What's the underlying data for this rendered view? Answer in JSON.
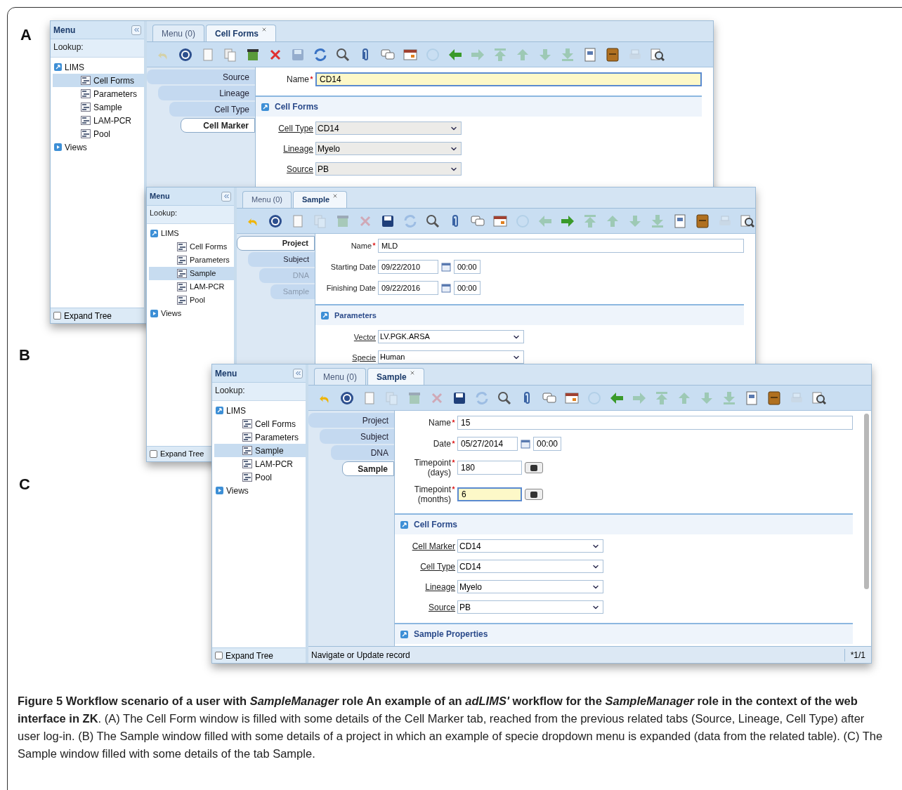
{
  "panel_labels": [
    "A",
    "B",
    "C"
  ],
  "windows": [
    {
      "sidebar": {
        "title": "Menu",
        "lookup": "Lookup:",
        "tree": [
          {
            "label": "LIMS",
            "expanded": true,
            "children": [
              {
                "label": "Cell Forms",
                "selected": true
              },
              {
                "label": "Parameters",
                "selected": false
              },
              {
                "label": "Sample",
                "selected": false
              },
              {
                "label": "LAM-PCR",
                "selected": false
              },
              {
                "label": "Pool",
                "selected": false
              }
            ]
          },
          {
            "label": "Views",
            "expanded": false
          }
        ],
        "expand_tree": {
          "label": "Expand Tree",
          "checked": false
        }
      },
      "tabs": [
        {
          "label": "Menu (0)",
          "selected": false,
          "closable": false
        },
        {
          "label": "Cell Forms",
          "selected": true,
          "closable": true
        }
      ],
      "toolbar": [
        {
          "kind": "undo",
          "disabled": true
        },
        {
          "kind": "help",
          "disabled": false
        },
        {
          "kind": "new",
          "disabled": false
        },
        {
          "kind": "copy",
          "disabled": false
        },
        {
          "kind": "bin",
          "disabled": false
        },
        {
          "kind": "delete",
          "disabled": false
        },
        {
          "kind": "save",
          "disabled": true
        },
        {
          "kind": "refresh",
          "disabled": false
        },
        {
          "kind": "search",
          "disabled": false
        },
        {
          "kind": "attach",
          "disabled": false
        },
        {
          "kind": "chat",
          "disabled": false
        },
        {
          "kind": "grid",
          "disabled": false
        },
        {
          "kind": "history",
          "disabled": true
        },
        {
          "kind": "back",
          "disabled": false
        },
        {
          "kind": "forward",
          "disabled": true
        },
        {
          "kind": "first",
          "disabled": true
        },
        {
          "kind": "up",
          "disabled": true
        },
        {
          "kind": "down",
          "disabled": true
        },
        {
          "kind": "last",
          "disabled": true
        },
        {
          "kind": "report",
          "disabled": false
        },
        {
          "kind": "archive",
          "disabled": false
        },
        {
          "kind": "print",
          "disabled": true
        },
        {
          "kind": "zoom",
          "disabled": false
        }
      ],
      "side_tabs": [
        {
          "label": "Source",
          "selected": false,
          "disabled": false
        },
        {
          "label": "Lineage",
          "selected": false,
          "disabled": false
        },
        {
          "label": "Cell Type",
          "selected": false,
          "disabled": false
        },
        {
          "label": "Cell Marker",
          "selected": true,
          "disabled": false
        }
      ],
      "fields": [
        {
          "kind": "text",
          "label": "Name",
          "required": true,
          "value": "CD14",
          "focused": true
        }
      ],
      "sections": [
        {
          "title": "Cell Forms",
          "fields": [
            {
              "kind": "select",
              "label": "Cell Type",
              "value": "CD14",
              "disabled": true
            },
            {
              "kind": "select",
              "label": "Lineage",
              "value": "Myelo",
              "disabled": true
            },
            {
              "kind": "select",
              "label": "Source",
              "value": "PB",
              "disabled": true
            }
          ]
        }
      ]
    },
    {
      "sidebar": {
        "title": "Menu",
        "lookup": "Lookup:",
        "tree": [
          {
            "label": "LIMS",
            "expanded": true,
            "children": [
              {
                "label": "Cell Forms",
                "selected": false
              },
              {
                "label": "Parameters",
                "selected": false
              },
              {
                "label": "Sample",
                "selected": true
              },
              {
                "label": "LAM-PCR",
                "selected": false
              },
              {
                "label": "Pool",
                "selected": false
              }
            ]
          },
          {
            "label": "Views",
            "expanded": false
          }
        ],
        "expand_tree": {
          "label": "Expand Tree",
          "checked": false
        }
      },
      "tabs": [
        {
          "label": "Menu (0)",
          "selected": false,
          "closable": false
        },
        {
          "label": "Sample",
          "selected": true,
          "closable": true
        }
      ],
      "toolbar": [
        {
          "kind": "undo",
          "disabled": false
        },
        {
          "kind": "help",
          "disabled": false
        },
        {
          "kind": "new",
          "disabled": false
        },
        {
          "kind": "copy",
          "disabled": true
        },
        {
          "kind": "bin",
          "disabled": true
        },
        {
          "kind": "delete",
          "disabled": true
        },
        {
          "kind": "save",
          "disabled": false
        },
        {
          "kind": "refresh",
          "disabled": true
        },
        {
          "kind": "search",
          "disabled": false
        },
        {
          "kind": "attach",
          "disabled": false
        },
        {
          "kind": "chat",
          "disabled": false
        },
        {
          "kind": "grid",
          "disabled": false
        },
        {
          "kind": "history",
          "disabled": true
        },
        {
          "kind": "back",
          "disabled": true
        },
        {
          "kind": "forward",
          "disabled": false
        },
        {
          "kind": "first",
          "disabled": true
        },
        {
          "kind": "up",
          "disabled": true
        },
        {
          "kind": "down",
          "disabled": true
        },
        {
          "kind": "last",
          "disabled": true
        },
        {
          "kind": "report",
          "disabled": false
        },
        {
          "kind": "archive",
          "disabled": false
        },
        {
          "kind": "print",
          "disabled": true
        },
        {
          "kind": "zoom",
          "disabled": false
        }
      ],
      "side_tabs": [
        {
          "label": "Project",
          "selected": true,
          "disabled": false
        },
        {
          "label": "Subject",
          "selected": false,
          "disabled": false
        },
        {
          "label": "DNA",
          "selected": false,
          "disabled": true
        },
        {
          "label": "Sample",
          "selected": false,
          "disabled": true
        }
      ],
      "fields": [
        {
          "kind": "text",
          "label": "Name",
          "required": true,
          "value": "MLD",
          "focused": false
        },
        {
          "kind": "date",
          "label": "Starting Date",
          "required": false,
          "value": "09/22/2010",
          "time": "00:00"
        },
        {
          "kind": "date",
          "label": "Finishing Date",
          "required": false,
          "value": "09/22/2016",
          "time": "00:00"
        }
      ],
      "sections": [
        {
          "title": "Parameters",
          "fields": [
            {
              "kind": "select",
              "label": "Vector",
              "value": "LV.PGK.ARSA",
              "disabled": false
            },
            {
              "kind": "select",
              "label": "Specie",
              "value": "Human",
              "disabled": false
            }
          ]
        }
      ]
    },
    {
      "sidebar": {
        "title": "Menu",
        "lookup": "Lookup:",
        "tree": [
          {
            "label": "LIMS",
            "expanded": true,
            "children": [
              {
                "label": "Cell Forms",
                "selected": false
              },
              {
                "label": "Parameters",
                "selected": false
              },
              {
                "label": "Sample",
                "selected": true
              },
              {
                "label": "LAM-PCR",
                "selected": false
              },
              {
                "label": "Pool",
                "selected": false
              }
            ]
          },
          {
            "label": "Views",
            "expanded": false
          }
        ],
        "expand_tree": {
          "label": "Expand Tree",
          "checked": false
        }
      },
      "tabs": [
        {
          "label": "Menu (0)",
          "selected": false,
          "closable": false
        },
        {
          "label": "Sample",
          "selected": true,
          "closable": true
        }
      ],
      "toolbar": [
        {
          "kind": "undo",
          "disabled": false
        },
        {
          "kind": "help",
          "disabled": false
        },
        {
          "kind": "new",
          "disabled": false
        },
        {
          "kind": "copy",
          "disabled": true
        },
        {
          "kind": "bin",
          "disabled": true
        },
        {
          "kind": "delete",
          "disabled": true
        },
        {
          "kind": "save",
          "disabled": false
        },
        {
          "kind": "refresh",
          "disabled": true
        },
        {
          "kind": "search",
          "disabled": false
        },
        {
          "kind": "attach",
          "disabled": false
        },
        {
          "kind": "chat",
          "disabled": false
        },
        {
          "kind": "grid",
          "disabled": false
        },
        {
          "kind": "history",
          "disabled": true
        },
        {
          "kind": "back",
          "disabled": false
        },
        {
          "kind": "forward",
          "disabled": true
        },
        {
          "kind": "first",
          "disabled": true
        },
        {
          "kind": "up",
          "disabled": true
        },
        {
          "kind": "down",
          "disabled": true
        },
        {
          "kind": "last",
          "disabled": true
        },
        {
          "kind": "report",
          "disabled": false
        },
        {
          "kind": "archive",
          "disabled": false
        },
        {
          "kind": "print",
          "disabled": true
        },
        {
          "kind": "zoom",
          "disabled": false
        }
      ],
      "side_tabs": [
        {
          "label": "Project",
          "selected": false,
          "disabled": false
        },
        {
          "label": "Subject",
          "selected": false,
          "disabled": false
        },
        {
          "label": "DNA",
          "selected": false,
          "disabled": false
        },
        {
          "label": "Sample",
          "selected": true,
          "disabled": false
        }
      ],
      "fields": [
        {
          "kind": "text",
          "label": "Name",
          "required": true,
          "value": "15",
          "focused": false
        },
        {
          "kind": "date",
          "label": "Date",
          "required": true,
          "value": "05/27/2014",
          "time": "00:00"
        },
        {
          "kind": "number",
          "label": "Timepoint (days)",
          "required": true,
          "value": "180",
          "focused": false
        },
        {
          "kind": "number",
          "label": "Timepoint (months)",
          "required": true,
          "value": "6",
          "focused": true
        }
      ],
      "sections": [
        {
          "title": "Cell Forms",
          "fields": [
            {
              "kind": "select",
              "label": "Cell Marker",
              "value": "CD14",
              "disabled": false
            },
            {
              "kind": "select",
              "label": "Cell Type",
              "value": "CD14",
              "disabled": false
            },
            {
              "kind": "select",
              "label": "Lineage",
              "value": "Myelo",
              "disabled": false
            },
            {
              "kind": "select",
              "label": "Source",
              "value": "PB",
              "disabled": false
            }
          ]
        },
        {
          "title": "Sample Properties"
        }
      ],
      "status_bar": {
        "message": "Navigate or Update record",
        "count": "*1/1"
      }
    }
  ],
  "caption": {
    "title": "Figure 5 Workflow scenario of a user with *SampleManager* role An example of an *adLIMS'* workflow for the *SampleManager* role in the context of the web interface in ZK",
    "text": ". (A) The Cell Form window is filled with some details of the Cell Marker tab, reached from the previous related tabs (Source, Lineage, Cell Type) after user log-in. (B) The Sample window filled with some details of a project in which an example of specie dropdown menu is expanded (data from the related table). (C) The Sample window filled with some details of the tab Sample."
  }
}
